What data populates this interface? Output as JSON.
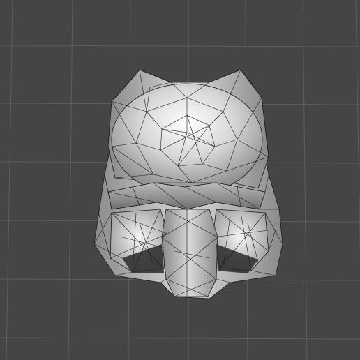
{
  "scene": {
    "background_color": "#454545",
    "grid_color": "#5e5e5e",
    "model": {
      "name": "helmet-mesh",
      "shading": "smooth-gray-with-wireframe",
      "wire_color": "#1a1a1a"
    }
  }
}
